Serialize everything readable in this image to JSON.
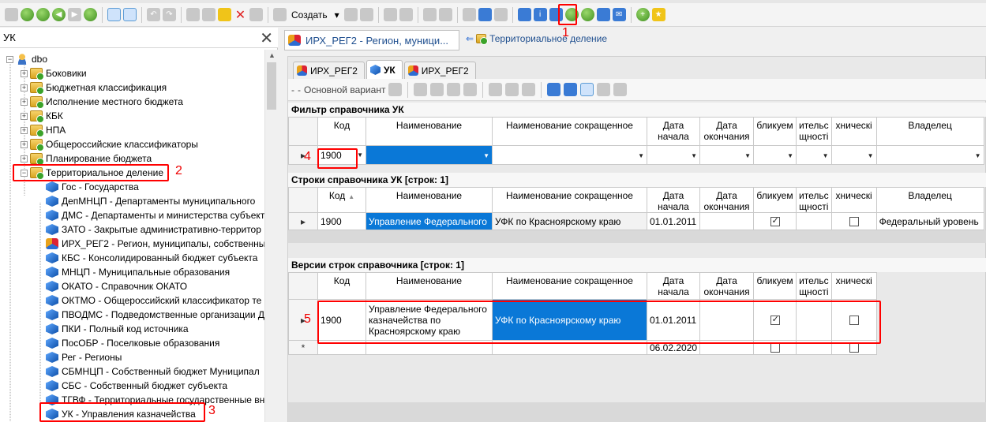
{
  "toolbar": {
    "create_label": "Создать"
  },
  "left": {
    "search_value": "УК",
    "root": "dbo",
    "items": [
      {
        "label": "Боковики",
        "icon": "folder-db-icon"
      },
      {
        "label": "Бюджетная классификация",
        "icon": "folder-db-icon"
      },
      {
        "label": "Исполнение местного бюджета",
        "icon": "folder-db-icon"
      },
      {
        "label": "КБК",
        "icon": "folder-db-icon"
      },
      {
        "label": "НПА",
        "icon": "folder-db-icon"
      },
      {
        "label": "Общероссийские классификаторы",
        "icon": "folder-db-icon"
      },
      {
        "label": "Планирование бюджета",
        "icon": "folder-db-icon"
      },
      {
        "label": "Территориальное деление",
        "icon": "folder-db-icon"
      }
    ],
    "children": [
      "Гос - Государства",
      "ДепМНЦП - Департаменты муниципального",
      "ДМС - Департаменты и министерства субъект",
      "ЗАТО - Закрытые административно-территор",
      "ИРХ_РЕГ2 - Регион, муниципалы, собственны",
      "КБС - Консолидированный бюджет субъекта",
      "МНЦП - Муниципальные образования",
      "ОКАТО - Справочник ОКАТО",
      "ОКТМО - Общероссийский классификатор те",
      "ПВОДМС - Подведомственные организации Д",
      "ПКИ - Полный код источника",
      "ПосОБР - Поселковые образования",
      "Рег - Регионы",
      "СБМНЦП - Собственный бюджет Муниципал",
      "СБС - Собственный бюджет субъекта",
      "ТГВФ - Территориальные государственные вн",
      "УК - Управления казначейства"
    ]
  },
  "right": {
    "doc_tab": "ИРХ_РЕГ2 - Регион, муници...",
    "breadcrumb": "Территориальное деление",
    "tabs": [
      "ИРХ_РЕГ2",
      "УК",
      "ИРХ_РЕГ2"
    ],
    "variant_label": "Основной вариант",
    "filter_title": "Фильтр справочника УК",
    "rows_title": "Строки справочника УК [строк: 1]",
    "versions_title": "Версии строк справочника [строк: 1]",
    "columns": {
      "code": "Код",
      "name": "Наименование",
      "short": "Наименование сокращенное",
      "start1": "Дата",
      "start2": "начала",
      "end1": "Дата",
      "end2": "окончания",
      "pub": "бликуем",
      "add1": "ительс",
      "add2": "щностi",
      "tech": "хническі",
      "owner": "Владелец"
    },
    "filter_row": {
      "code": "1900"
    },
    "rows": [
      {
        "code": "1900",
        "name": "Управление Федерального",
        "short": "УФК по Красноярскому краю",
        "start": "01.01.2011",
        "pub": true,
        "tech": false,
        "owner": "Федеральный уровень"
      }
    ],
    "versions": [
      {
        "code": "1900",
        "name1": "Управление Федерального",
        "name2": "казначейства по",
        "name3": "Красноярскому краю",
        "short": "УФК по Красноярскому краю",
        "start": "01.01.2011",
        "pub": true,
        "tech": false
      },
      {
        "start": "06.02.2020",
        "newrow_marker": "*"
      }
    ]
  },
  "annotations": [
    "1",
    "2",
    "3",
    "4",
    "5"
  ]
}
